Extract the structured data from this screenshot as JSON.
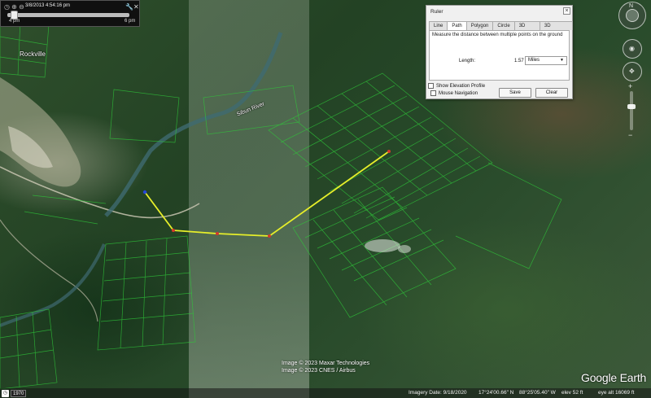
{
  "timeslider": {
    "date": "3/8/2013  4:54:16 pm",
    "start_label": "4 pm",
    "end_label": "6 pm"
  },
  "ruler": {
    "title": "Ruler",
    "tabs": [
      "Line",
      "Path",
      "Polygon",
      "Circle",
      "3D path",
      "3D polygon"
    ],
    "active_tab": "Path",
    "description": "Measure the distance between multiple points on the ground",
    "length_label": "Length:",
    "length_value": "1.57",
    "unit": "Miles",
    "show_elevation": "Show Elevation Profile",
    "mouse_navigation": "Mouse Navigation",
    "save": "Save",
    "clear": "Clear"
  },
  "map": {
    "place_label": "Rockville",
    "river_label": "Sibun River",
    "credits": [
      "Image © 2023 Maxar Technologies",
      "Image © 2023 CNES / Airbus"
    ],
    "logo": "Google Earth",
    "path_color": "#e6ee2a",
    "grid_color": "#2fc93a",
    "vertex_color": "#d4382b",
    "start_vertex_color": "#2646d9"
  },
  "statusbar": {
    "year": "1970",
    "imagery_date": "Imagery Date: 9/18/2020",
    "lat": "17°24'00.66\" N",
    "lon": "88°25'05.40\" W",
    "elev": "elev   52 ft",
    "eye_alt": "eye alt  16069 ft"
  },
  "icons": {
    "compass": "compass-north-icon",
    "look": "look-joystick-icon",
    "move": "move-joystick-icon",
    "person": "street-view-person-icon",
    "zoom_in": "plus-icon",
    "zoom_out": "minus-icon"
  }
}
